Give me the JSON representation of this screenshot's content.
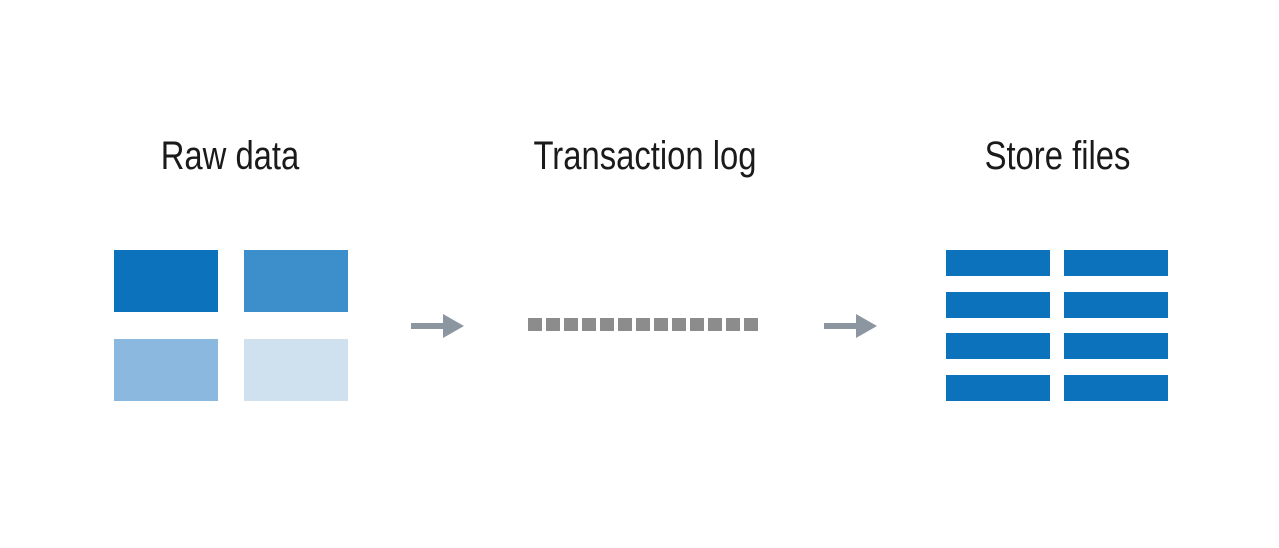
{
  "stages": [
    {
      "id": "raw",
      "label": "Raw data"
    },
    {
      "id": "log",
      "label": "Transaction log"
    },
    {
      "id": "store",
      "label": "Store files"
    }
  ],
  "colors": {
    "raw_block_1": "#0b72bb",
    "raw_block_2": "#3d8fcc",
    "raw_block_3": "#8ab8de",
    "raw_block_4": "#cfe1ef",
    "store_block": "#0b72bb",
    "log_dash": "#8c8c8c",
    "arrow": "#8c96a0",
    "text": "#1a1a1a"
  }
}
